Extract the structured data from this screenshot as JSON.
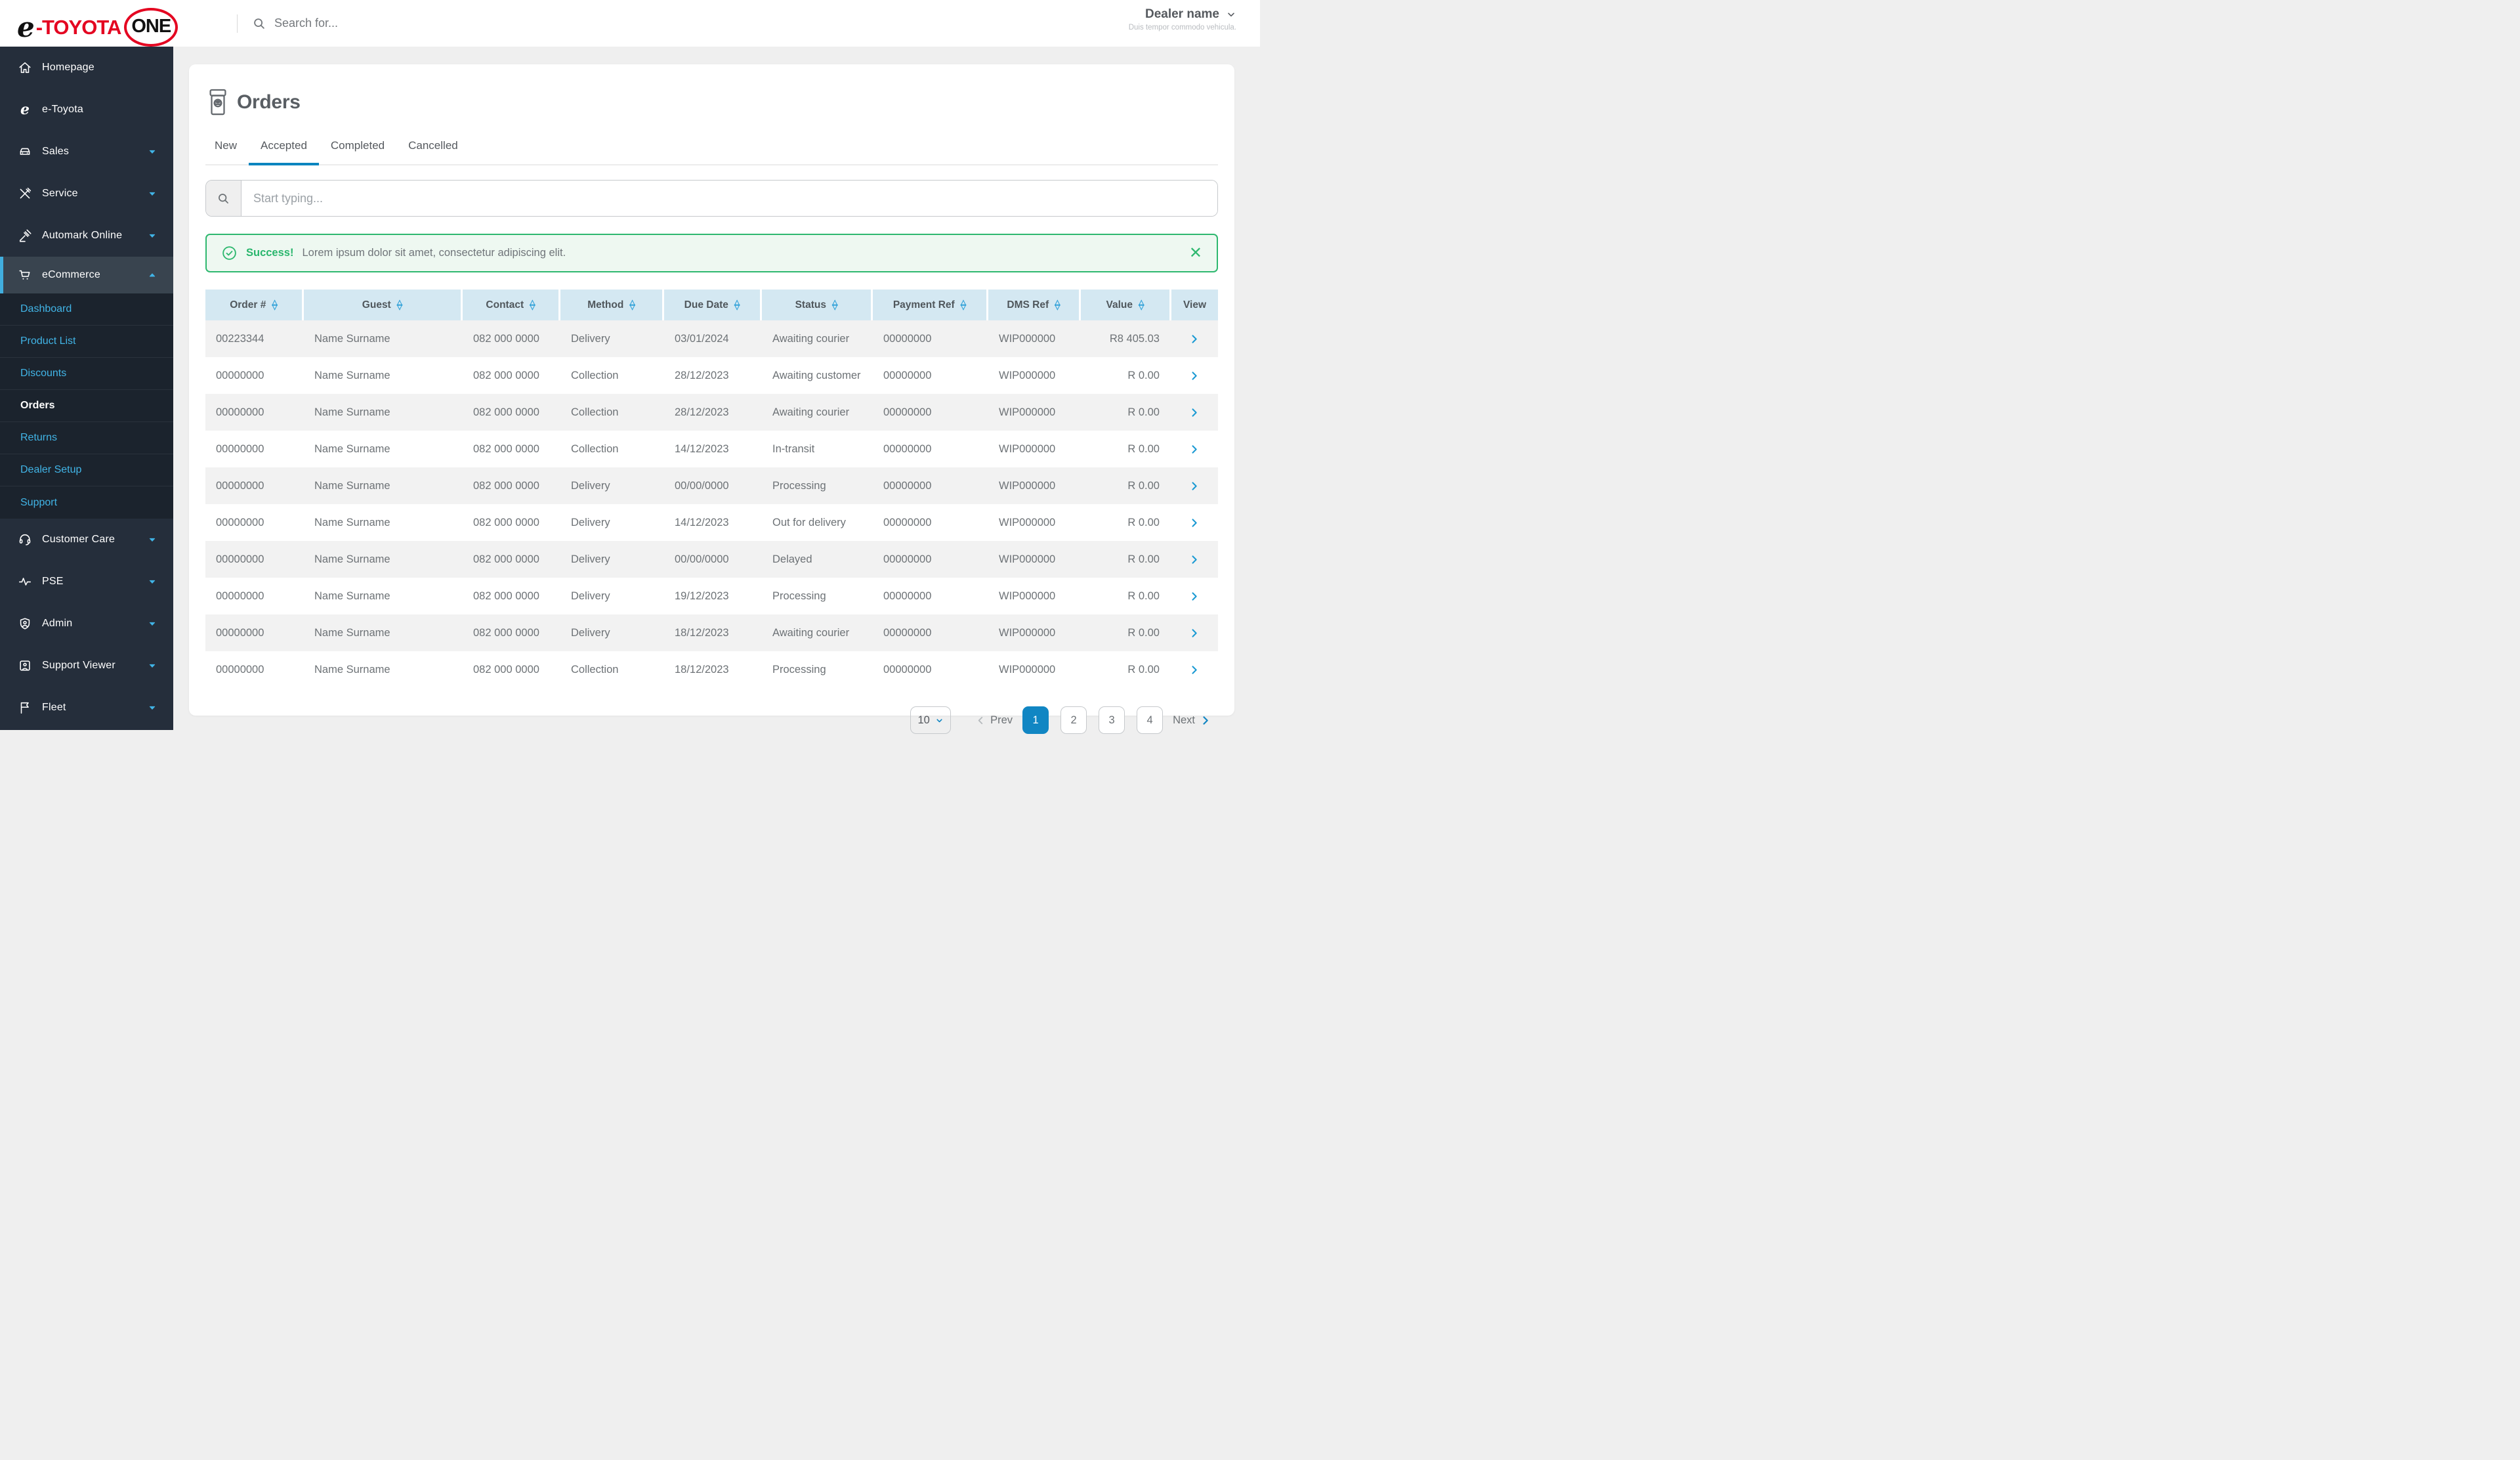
{
  "topbar": {
    "logo": {
      "e": "e",
      "toyota": "-TOYOTA",
      "one": "ONE"
    },
    "search_placeholder": "Search for...",
    "dealer": {
      "name": "Dealer name",
      "subtitle": "Duis tempor commodo vehicula."
    }
  },
  "sidebar": {
    "items": [
      {
        "label": "Homepage"
      },
      {
        "label": "e-Toyota"
      },
      {
        "label": "Sales"
      },
      {
        "label": "Service"
      },
      {
        "label": "Automark Online"
      }
    ],
    "ecommerce": {
      "label": "eCommerce",
      "items": [
        {
          "label": "Dashboard"
        },
        {
          "label": "Product List"
        },
        {
          "label": "Discounts"
        },
        {
          "label": "Orders",
          "active": true
        },
        {
          "label": "Returns"
        },
        {
          "label": "Dealer Setup"
        },
        {
          "label": "Support"
        }
      ]
    },
    "bottom_items": [
      {
        "label": "Customer Care"
      },
      {
        "label": "PSE"
      },
      {
        "label": "Admin"
      },
      {
        "label": "Support Viewer"
      },
      {
        "label": "Fleet"
      }
    ]
  },
  "page": {
    "title": "Orders",
    "tabs": [
      {
        "label": "New"
      },
      {
        "label": "Accepted",
        "active": true
      },
      {
        "label": "Completed"
      },
      {
        "label": "Cancelled"
      }
    ],
    "search_placeholder": "Start typing...",
    "alert": {
      "title": "Success!",
      "message": "Lorem ipsum dolor sit amet, consectetur adipiscing elit."
    }
  },
  "table": {
    "columns": [
      {
        "label": "Order #",
        "sortable": true
      },
      {
        "label": "Guest",
        "sortable": true
      },
      {
        "label": "Contact",
        "sortable": true
      },
      {
        "label": "Method",
        "sortable": true
      },
      {
        "label": "Due Date",
        "sortable": true
      },
      {
        "label": "Status",
        "sortable": true
      },
      {
        "label": "Payment Ref",
        "sortable": true
      },
      {
        "label": "DMS Ref",
        "sortable": true
      },
      {
        "label": "Value",
        "sortable": true
      },
      {
        "label": "View",
        "sortable": false
      }
    ],
    "rows": [
      {
        "order": "00223344",
        "guest": "Name Surname",
        "contact": "082 000 0000",
        "method": "Delivery",
        "due": "03/01/2024",
        "status": "Awaiting courier",
        "payment": "00000000",
        "dms": "WIP000000",
        "value": "R8 405.03"
      },
      {
        "order": "00000000",
        "guest": "Name Surname",
        "contact": "082 000 0000",
        "method": "Collection",
        "due": "28/12/2023",
        "status": "Awaiting customer",
        "payment": "00000000",
        "dms": "WIP000000",
        "value": "R 0.00"
      },
      {
        "order": "00000000",
        "guest": "Name Surname",
        "contact": "082 000 0000",
        "method": "Collection",
        "due": "28/12/2023",
        "status": "Awaiting courier",
        "payment": "00000000",
        "dms": "WIP000000",
        "value": "R 0.00"
      },
      {
        "order": "00000000",
        "guest": "Name Surname",
        "contact": "082 000 0000",
        "method": "Collection",
        "due": "14/12/2023",
        "status": "In-transit",
        "payment": "00000000",
        "dms": "WIP000000",
        "value": "R 0.00"
      },
      {
        "order": "00000000",
        "guest": "Name Surname",
        "contact": "082 000 0000",
        "method": "Delivery",
        "due": "00/00/0000",
        "status": "Processing",
        "payment": "00000000",
        "dms": "WIP000000",
        "value": "R 0.00"
      },
      {
        "order": "00000000",
        "guest": "Name Surname",
        "contact": "082 000 0000",
        "method": "Delivery",
        "due": "14/12/2023",
        "status": "Out for delivery",
        "payment": "00000000",
        "dms": "WIP000000",
        "value": "R 0.00"
      },
      {
        "order": "00000000",
        "guest": "Name Surname",
        "contact": "082 000 0000",
        "method": "Delivery",
        "due": "00/00/0000",
        "status": "Delayed",
        "payment": "00000000",
        "dms": "WIP000000",
        "value": "R 0.00"
      },
      {
        "order": "00000000",
        "guest": "Name Surname",
        "contact": "082 000 0000",
        "method": "Delivery",
        "due": "19/12/2023",
        "status": "Processing",
        "payment": "00000000",
        "dms": "WIP000000",
        "value": "R 0.00"
      },
      {
        "order": "00000000",
        "guest": "Name Surname",
        "contact": "082 000 0000",
        "method": "Delivery",
        "due": "18/12/2023",
        "status": "Awaiting courier",
        "payment": "00000000",
        "dms": "WIP000000",
        "value": "R 0.00"
      },
      {
        "order": "00000000",
        "guest": "Name Surname",
        "contact": "082 000 0000",
        "method": "Collection",
        "due": "18/12/2023",
        "status": "Processing",
        "payment": "00000000",
        "dms": "WIP000000",
        "value": "R 0.00"
      }
    ]
  },
  "pagination": {
    "page_size": "10",
    "prev_label": "Prev",
    "next_label": "Next",
    "pages": [
      "1",
      "2",
      "3",
      "4"
    ],
    "active_page": "1"
  },
  "colors": {
    "toyota_red": "#e40521",
    "accent_blue": "#1186c3",
    "sidebar_link_blue": "#41b4e6",
    "success_green": "#2eb86f",
    "table_header_blue": "#d4e8f2"
  }
}
